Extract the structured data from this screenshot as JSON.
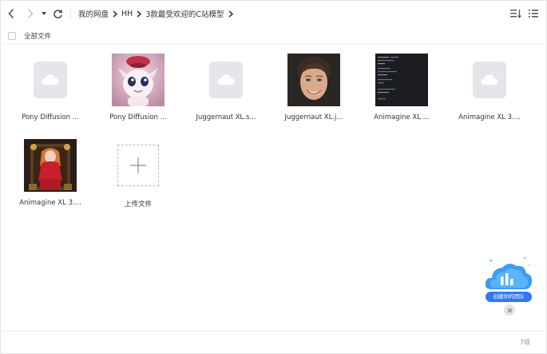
{
  "toolbar": {
    "back_icon": "chevron-left-icon",
    "forward_icon": "chevron-right-icon",
    "dropdown_icon": "caret-down-icon",
    "refresh_icon": "refresh-icon",
    "sort_icon": "sort-icon",
    "view_icon": "list-view-icon"
  },
  "breadcrumb": [
    "我的网盘",
    "HH",
    "3款最受欢迎的C站模型"
  ],
  "header": {
    "select_all_label": "全部文件"
  },
  "files": [
    {
      "name": "Pony Diffusion ...",
      "thumb": "doc"
    },
    {
      "name": "Pony Diffusion ...",
      "thumb": "pony"
    },
    {
      "name": "Juggernaut XL.s...",
      "thumb": "doc"
    },
    {
      "name": "Juggernaut XL.j...",
      "thumb": "face"
    },
    {
      "name": "Animagine XL ...",
      "thumb": "terminal"
    },
    {
      "name": "Animagine XL 3....",
      "thumb": "doc"
    },
    {
      "name": "Animagine XL 3....",
      "thumb": "anime"
    }
  ],
  "upload": {
    "label": "上传文件"
  },
  "team_widget": {
    "label": "创建你的团队"
  },
  "footer": {
    "count": "7项"
  },
  "colors": {
    "accent": "#2e7bf0",
    "doc_bg": "#e4e6ea",
    "border": "#e3e5e8"
  }
}
